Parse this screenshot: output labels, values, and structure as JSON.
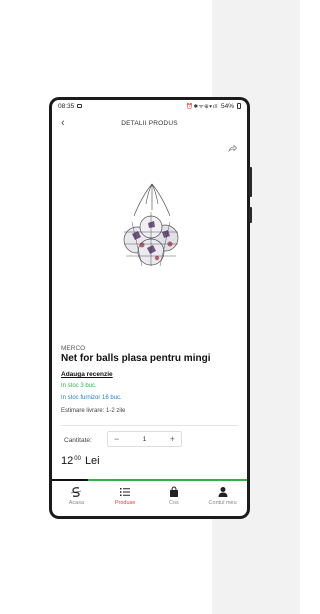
{
  "statusbar": {
    "time": "08:35",
    "battery": "54%"
  },
  "header": {
    "title": "DETALII PRODUS"
  },
  "product": {
    "brand": "MERCO",
    "title": "Net for balls plasa pentru mingi",
    "review_link": "Adauga recenzie",
    "stock_store": "In stoc 3 buc.",
    "stock_supplier": "In stoc furnizor 16 buc.",
    "delivery": "Estimare livrare:  1-2 zile",
    "quantity_label": "Cantitate:",
    "quantity_value": "1",
    "price_main": "12",
    "price_cents": "00",
    "currency": "Lei"
  },
  "progress": {
    "value": 1.0
  },
  "tabs": [
    {
      "label": "Acasa",
      "icon": "home-logo-icon"
    },
    {
      "label": "Produse",
      "icon": "list-icon",
      "active": true
    },
    {
      "label": "Cos",
      "icon": "bag-icon"
    },
    {
      "label": "Contul meu",
      "icon": "user-icon"
    }
  ],
  "colors": {
    "accent_red": "#d4423a",
    "stock_green": "#2eb24a",
    "stock_blue": "#1e7ec8",
    "progress_green": "#2eb24a"
  }
}
